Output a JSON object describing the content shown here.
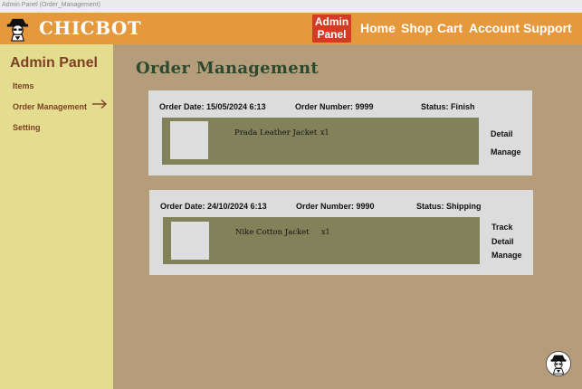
{
  "browser": {
    "tab_title": "Admin Panel (Order_Management)"
  },
  "header": {
    "brand": "CHICBOT",
    "admin_button": "Admin Panel",
    "nav": {
      "home": "Home",
      "shop": "Shop",
      "cart": "Cart",
      "account": "Account",
      "support": "Support"
    },
    "colors": {
      "bar": "#e5983c",
      "admin_button": "#d43b24"
    }
  },
  "sidebar": {
    "title": "Admin Panel",
    "items": [
      {
        "label": "Items"
      },
      {
        "label": "Order Management",
        "active": true
      },
      {
        "label": "Setting"
      }
    ]
  },
  "main": {
    "title": "Order Management",
    "orders": [
      {
        "date": "Order Date: 15/05/2024 6:13",
        "number": "Order Number: 9999",
        "status": "Status: Finish",
        "item_name": "Prada Leather Jacket",
        "quantity": "x1",
        "actions": [
          "Detail",
          "Manage"
        ]
      },
      {
        "date": "Order Date: 24/10/2024 6:13",
        "number": "Order Number: 9990",
        "status": "Status: Shipping",
        "item_name": "Nike Cotton Jacket",
        "quantity": "x1",
        "actions": [
          "Track",
          "Detail",
          "Manage"
        ]
      }
    ]
  }
}
